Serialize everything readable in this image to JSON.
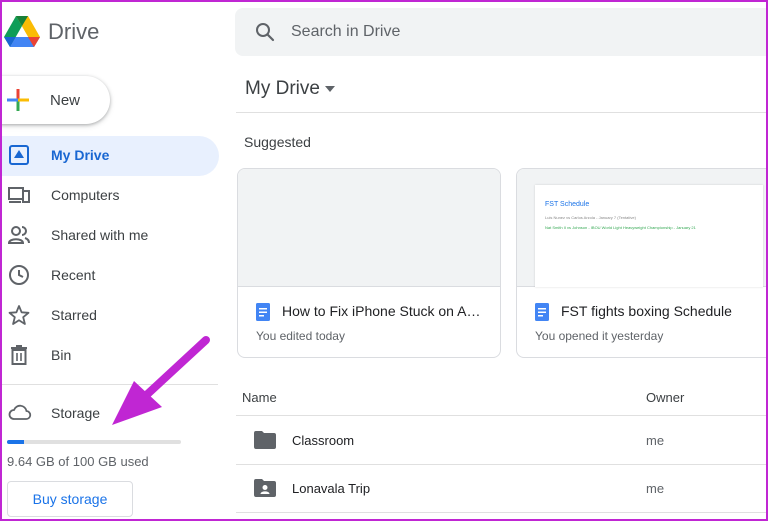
{
  "app": {
    "name": "Drive"
  },
  "search": {
    "placeholder": "Search in Drive"
  },
  "sidebar": {
    "new_label": "New",
    "items": [
      {
        "label": "My Drive",
        "icon": "my-drive-icon",
        "active": true
      },
      {
        "label": "Computers",
        "icon": "computers-icon"
      },
      {
        "label": "Shared with me",
        "icon": "shared-icon"
      },
      {
        "label": "Recent",
        "icon": "clock-icon"
      },
      {
        "label": "Starred",
        "icon": "star-icon"
      },
      {
        "label": "Bin",
        "icon": "trash-icon"
      }
    ],
    "storage": {
      "label": "Storage",
      "used_fraction": 0.0964,
      "usage_text": "9.64 GB of 100 GB used",
      "buy_label": "Buy storage"
    }
  },
  "main": {
    "title": "My Drive",
    "suggested_label": "Suggested",
    "cards": [
      {
        "name": "How to Fix iPhone Stuck on Appl...",
        "subtitle": "You edited today"
      },
      {
        "name": "FST fights boxing Schedule",
        "subtitle": "You opened it yesterday",
        "preview": {
          "title": "FST Schedule",
          "line1": "Luis Nunez vs Carlos Arzola - January 7 (Tentative)",
          "line2": "Nat Smith II vs Johnson - IBOU World Light Heavyweight Championship - January 21"
        }
      }
    ],
    "list": {
      "col_name": "Name",
      "col_owner": "Owner",
      "rows": [
        {
          "name": "Classroom",
          "owner": "me",
          "icon": "folder-icon"
        },
        {
          "name": "Lonavala Trip",
          "owner": "me",
          "icon": "shared-folder-icon"
        }
      ]
    }
  },
  "colors": {
    "accent": "#1a73e8",
    "active_bg": "#e8f0fe",
    "annotation_arrow": "#c026d3"
  }
}
